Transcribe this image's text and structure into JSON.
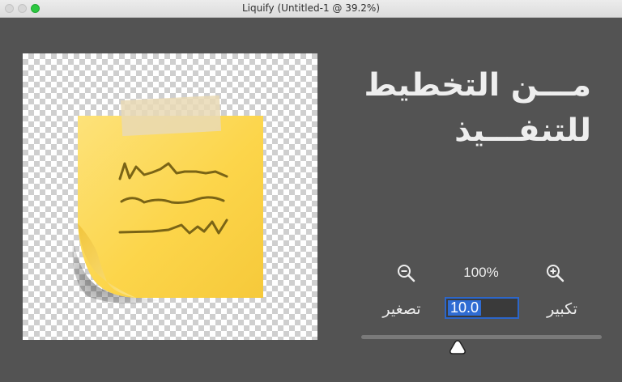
{
  "window": {
    "title": "Liquify (Untitled-1 @ 39.2%)"
  },
  "canvas": {
    "content": "sticky-note-illustration",
    "note_color": "#fcd54a",
    "tape_color": "#e9d9b5",
    "scribble_color": "#7a6416"
  },
  "overlay_text": {
    "line1": "مـــن التخطيط",
    "line2": "للتنفـــيذ"
  },
  "zoom": {
    "percent_label": "100%",
    "zoom_out_icon": "zoom-out-icon",
    "zoom_in_icon": "zoom-in-icon"
  },
  "brush": {
    "decrease_label": "تصغير",
    "increase_label": "تكبير",
    "size_value": "10.0",
    "slider_level": 0.4
  },
  "colors": {
    "background": "#535353",
    "accent": "#2f6cd3",
    "text": "#eeeeee"
  }
}
